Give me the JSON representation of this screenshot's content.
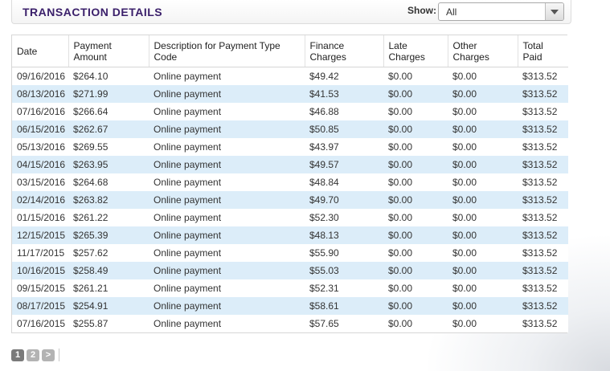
{
  "header": {
    "title": "TRANSACTION DETAILS",
    "show_label": "Show:",
    "show_value": "All"
  },
  "table": {
    "columns": [
      "Date",
      "Payment Amount",
      "Description for Payment Type Code",
      "Finance Charges",
      "Late Charges",
      "Other Charges",
      "Total Paid"
    ],
    "rows": [
      [
        "09/16/2016",
        "$264.10",
        "Online payment",
        "$49.42",
        "$0.00",
        "$0.00",
        "$313.52"
      ],
      [
        "08/13/2016",
        "$271.99",
        "Online payment",
        "$41.53",
        "$0.00",
        "$0.00",
        "$313.52"
      ],
      [
        "07/16/2016",
        "$266.64",
        "Online payment",
        "$46.88",
        "$0.00",
        "$0.00",
        "$313.52"
      ],
      [
        "06/15/2016",
        "$262.67",
        "Online payment",
        "$50.85",
        "$0.00",
        "$0.00",
        "$313.52"
      ],
      [
        "05/13/2016",
        "$269.55",
        "Online payment",
        "$43.97",
        "$0.00",
        "$0.00",
        "$313.52"
      ],
      [
        "04/15/2016",
        "$263.95",
        "Online payment",
        "$49.57",
        "$0.00",
        "$0.00",
        "$313.52"
      ],
      [
        "03/15/2016",
        "$264.68",
        "Online payment",
        "$48.84",
        "$0.00",
        "$0.00",
        "$313.52"
      ],
      [
        "02/14/2016",
        "$263.82",
        "Online payment",
        "$49.70",
        "$0.00",
        "$0.00",
        "$313.52"
      ],
      [
        "01/15/2016",
        "$261.22",
        "Online payment",
        "$52.30",
        "$0.00",
        "$0.00",
        "$313.52"
      ],
      [
        "12/15/2015",
        "$265.39",
        "Online payment",
        "$48.13",
        "$0.00",
        "$0.00",
        "$313.52"
      ],
      [
        "11/17/2015",
        "$257.62",
        "Online payment",
        "$55.90",
        "$0.00",
        "$0.00",
        "$313.52"
      ],
      [
        "10/16/2015",
        "$258.49",
        "Online payment",
        "$55.03",
        "$0.00",
        "$0.00",
        "$313.52"
      ],
      [
        "09/15/2015",
        "$261.21",
        "Online payment",
        "$52.31",
        "$0.00",
        "$0.00",
        "$313.52"
      ],
      [
        "08/17/2015",
        "$254.91",
        "Online payment",
        "$58.61",
        "$0.00",
        "$0.00",
        "$313.52"
      ],
      [
        "07/16/2015",
        "$255.87",
        "Online payment",
        "$57.65",
        "$0.00",
        "$0.00",
        "$313.52"
      ]
    ]
  },
  "pager": {
    "pages": [
      "1",
      "2"
    ],
    "current": "1",
    "next_label": ">"
  },
  "colors": {
    "title": "#3a1f6a",
    "row_alt": "#dcedf9"
  }
}
